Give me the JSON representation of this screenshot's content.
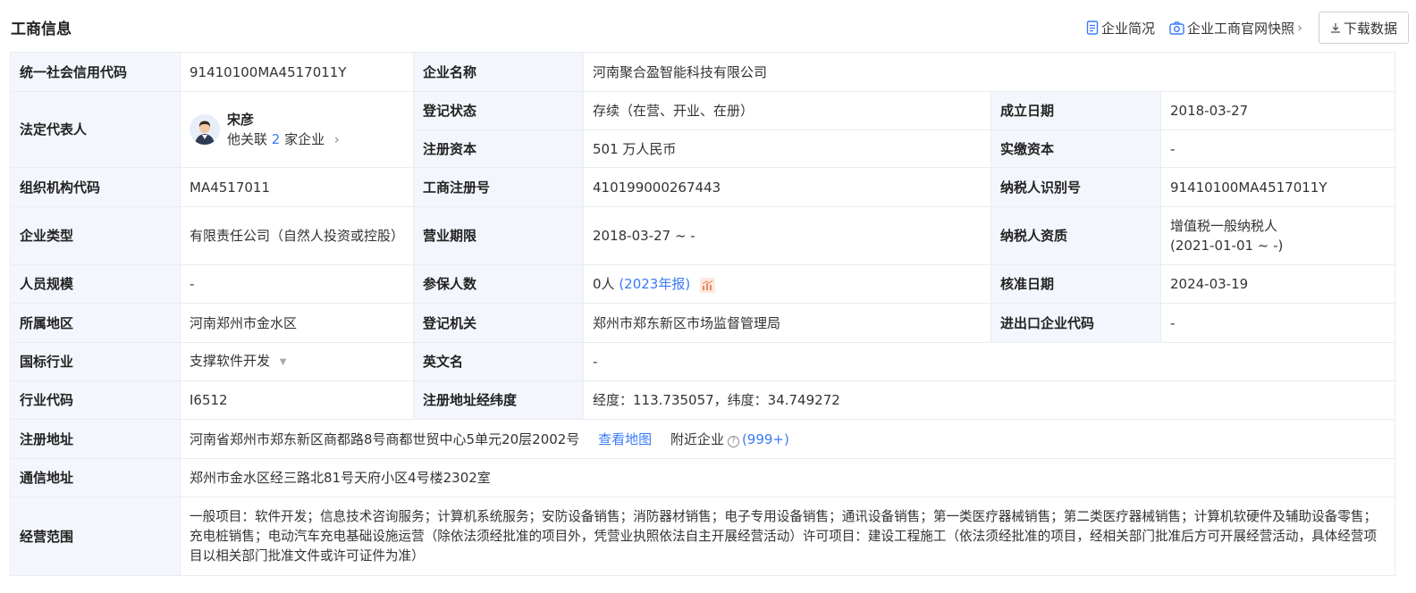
{
  "header": {
    "title": "工商信息",
    "brief_label": "企业简况",
    "snapshot_label": "企业工商官网快照",
    "download_label": "下载数据"
  },
  "rows": {
    "credit_code": {
      "label": "统一社会信用代码",
      "value": "91410100MA4517011Y"
    },
    "company_name": {
      "label": "企业名称",
      "value": "河南聚合盈智能科技有限公司"
    },
    "legal_rep": {
      "label": "法定代表人",
      "name": "宋彦",
      "related_prefix": "他关联",
      "related_count": "2",
      "related_suffix": "家企业"
    },
    "reg_status": {
      "label": "登记状态",
      "value": "存续（在营、开业、在册）"
    },
    "founded": {
      "label": "成立日期",
      "value": "2018-03-27"
    },
    "reg_capital": {
      "label": "注册资本",
      "value": "501 万人民币"
    },
    "paid_capital": {
      "label": "实缴资本",
      "value": "-"
    },
    "org_code": {
      "label": "组织机构代码",
      "value": "MA4517011"
    },
    "biz_reg_no": {
      "label": "工商注册号",
      "value": "410199000267443"
    },
    "taxpayer_id": {
      "label": "纳税人识别号",
      "value": "91410100MA4517011Y"
    },
    "company_type": {
      "label": "企业类型",
      "value": "有限责任公司（自然人投资或控股）"
    },
    "biz_term": {
      "label": "营业期限",
      "value": "2018-03-27 ~ -"
    },
    "taxpayer_qual": {
      "label": "纳税人资质",
      "value_line1": "增值税一般纳税人",
      "value_line2": "(2021-01-01 ~ -)"
    },
    "staff_size": {
      "label": "人员规模",
      "value": "-"
    },
    "insured": {
      "label": "参保人数",
      "value": "0人",
      "report": "(2023年报)"
    },
    "approval_date": {
      "label": "核准日期",
      "value": "2024-03-19"
    },
    "region": {
      "label": "所属地区",
      "value": "河南郑州市金水区"
    },
    "reg_authority": {
      "label": "登记机关",
      "value": "郑州市郑东新区市场监督管理局"
    },
    "import_export": {
      "label": "进出口企业代码",
      "value": "-"
    },
    "industry": {
      "label": "国标行业",
      "value": "支撑软件开发"
    },
    "english_name": {
      "label": "英文名",
      "value": "-"
    },
    "industry_code": {
      "label": "行业代码",
      "value": "I6512"
    },
    "coordinates": {
      "label": "注册地址经纬度",
      "value": "经度：113.735057，纬度：34.749272"
    },
    "reg_address": {
      "label": "注册地址",
      "value": "河南省郑州市郑东新区商都路8号商都世贸中心5单元20层2002号",
      "map_link": "查看地图",
      "nearby_label": "附近企业",
      "nearby_count": "(999+)"
    },
    "mail_address": {
      "label": "通信地址",
      "value": "郑州市金水区经三路北81号天府小区4号楼2302室"
    },
    "scope": {
      "label": "经营范围",
      "value": "一般项目：软件开发；信息技术咨询服务；计算机系统服务；安防设备销售；消防器材销售；电子专用设备销售；通讯设备销售；第一类医疗器械销售；第二类医疗器械销售；计算机软硬件及辅助设备零售；充电桩销售；电动汽车充电基础设施运营（除依法须经批准的项目外，凭营业执照依法自主开展经营活动）许可项目：建设工程施工（依法须经批准的项目，经相关部门批准后方可开展经营活动，具体经营项目以相关部门批准文件或许可证件为准）"
    }
  }
}
